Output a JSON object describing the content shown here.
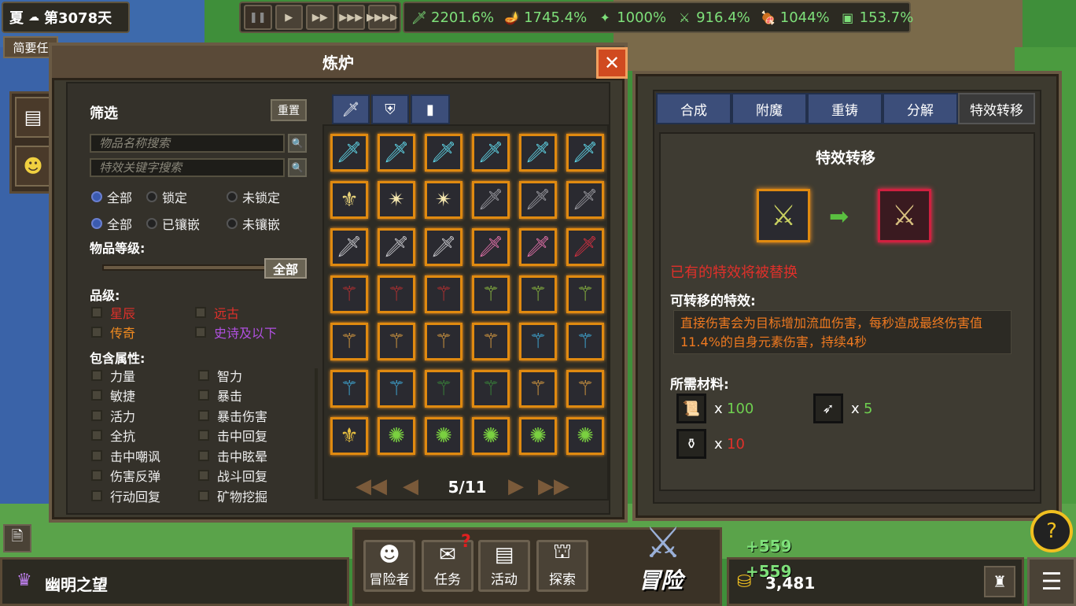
{
  "season": "夏",
  "day_label": "第3078天",
  "speed_buttons": [
    "❚❚",
    "▶",
    "▶▶",
    "▶▶▶",
    "▶▶▶▶"
  ],
  "stats": [
    {
      "icon": "sword-icon",
      "glyph": "🗡",
      "value": "2201.6%"
    },
    {
      "icon": "lamp-icon",
      "glyph": "🪔",
      "value": "1745.4%"
    },
    {
      "icon": "spirit-icon",
      "glyph": "✦",
      "value": "1000%"
    },
    {
      "icon": "wand-icon",
      "glyph": "⚔",
      "value": "916.4%"
    },
    {
      "icon": "food-icon",
      "glyph": "🍖",
      "value": "1044%"
    },
    {
      "icon": "chest-icon",
      "glyph": "▣",
      "value": "153.7%"
    }
  ],
  "brief_tab": "简要任",
  "furnace": {
    "title": "炼炉",
    "close": "✕",
    "filter": {
      "title": "筛选",
      "reset": "重置",
      "name_placeholder": "物品名称搜索",
      "effect_placeholder": "特效关键字搜索",
      "lock_options": [
        "全部",
        "锁定",
        "未锁定"
      ],
      "socket_options": [
        "全部",
        "已镶嵌",
        "未镶嵌"
      ],
      "level_label": "物品等级:",
      "level_value": "全部",
      "grade_label": "品级:",
      "grades": [
        {
          "label": "星辰",
          "color": "#e0302a"
        },
        {
          "label": "远古",
          "color": "#e0302a"
        },
        {
          "label": "传奇",
          "color": "#f08a20"
        },
        {
          "label": "史诗及以下",
          "color": "#b050e0"
        }
      ],
      "attr_label": "包含属性:",
      "attrs": [
        "力量",
        "智力",
        "敏捷",
        "暴击",
        "活力",
        "暴击伤害",
        "全抗",
        "击中回复",
        "击中嘲讽",
        "击中眩晕",
        "伤害反弹",
        "战斗回复",
        "行动回复",
        "矿物挖掘"
      ]
    },
    "item_tabs": [
      "weapon-tab-icon",
      "armor-tab-icon",
      "accessory-tab-icon"
    ],
    "items": [
      "🗡",
      "🗡",
      "🗡",
      "🗡",
      "🗡",
      "🗡",
      "⚜",
      "✴",
      "✴",
      "🗡",
      "🗡",
      "🗡",
      "🗡",
      "🗡",
      "🗡",
      "🗡",
      "🗡",
      "🗡",
      "⚚",
      "⚚",
      "⚚",
      "⚚",
      "⚚",
      "⚚",
      "⚚",
      "⚚",
      "⚚",
      "⚚",
      "⚚",
      "⚚",
      "⚚",
      "⚚",
      "⚚",
      "⚚",
      "⚚",
      "⚚",
      "⚜",
      "✺",
      "✺",
      "✺",
      "✺",
      "✺"
    ],
    "item_colors": [
      "#5fd6e8",
      "#5fd6e8",
      "#5fd6e8",
      "#5fd6e8",
      "#5fd6e8",
      "#5fd6e8",
      "#e8d27a",
      "#f6e8b0",
      "#f6e8b0",
      "#9a9aa0",
      "#9a9aa0",
      "#9a9aa0",
      "#c8c8cc",
      "#c8c8cc",
      "#c8c8cc",
      "#e070a8",
      "#e070a8",
      "#d03040",
      "#c03030",
      "#c03030",
      "#c03030",
      "#90c040",
      "#90c040",
      "#90c040",
      "#e0a040",
      "#e0a040",
      "#e0a040",
      "#e0a040",
      "#40b0e0",
      "#40b0e0",
      "#40b0e0",
      "#40b0e0",
      "#3a8a3a",
      "#3a8a3a",
      "#e0a040",
      "#e0a040",
      "#e8c040",
      "#7ad040",
      "#7ad040",
      "#7ad040",
      "#7ad040",
      "#7ad040"
    ],
    "page": "5/11"
  },
  "transfer": {
    "tabs": [
      "合成",
      "附魔",
      "重铸",
      "分解",
      "特效转移"
    ],
    "title": "特效转移",
    "warning": "已有的特效将被替换",
    "effect_label": "可转移的特效:",
    "effect_text": "直接伤害会为目标增加流血伤害，每秒造成最终伤害值11.4%的自身元素伤害，持续4秒",
    "materials_label": "所需材料:",
    "materials": [
      {
        "icon": "scroll-icon",
        "glyph": "📜",
        "qty": "100",
        "color": "#6fd050"
      },
      {
        "icon": "feather-icon",
        "glyph": "➶",
        "qty": "5",
        "color": "#6fd050"
      },
      {
        "icon": "potion-icon",
        "glyph": "⚱",
        "qty": "10",
        "color": "#e0302a"
      }
    ],
    "times": "x"
  },
  "bottom": {
    "player": "幽明之望",
    "nav": [
      {
        "label": "冒险者",
        "icon": "adventurer-icon",
        "glyph": "☻"
      },
      {
        "label": "任务",
        "icon": "quest-icon",
        "glyph": "✉"
      },
      {
        "label": "活动",
        "icon": "event-icon",
        "glyph": "▤"
      },
      {
        "label": "探索",
        "icon": "explore-icon",
        "glyph": "⛫"
      }
    ],
    "adventure": "冒险",
    "quest_alert": "?",
    "gain1": "+559",
    "gain2": "+559",
    "gold": "3,481"
  }
}
